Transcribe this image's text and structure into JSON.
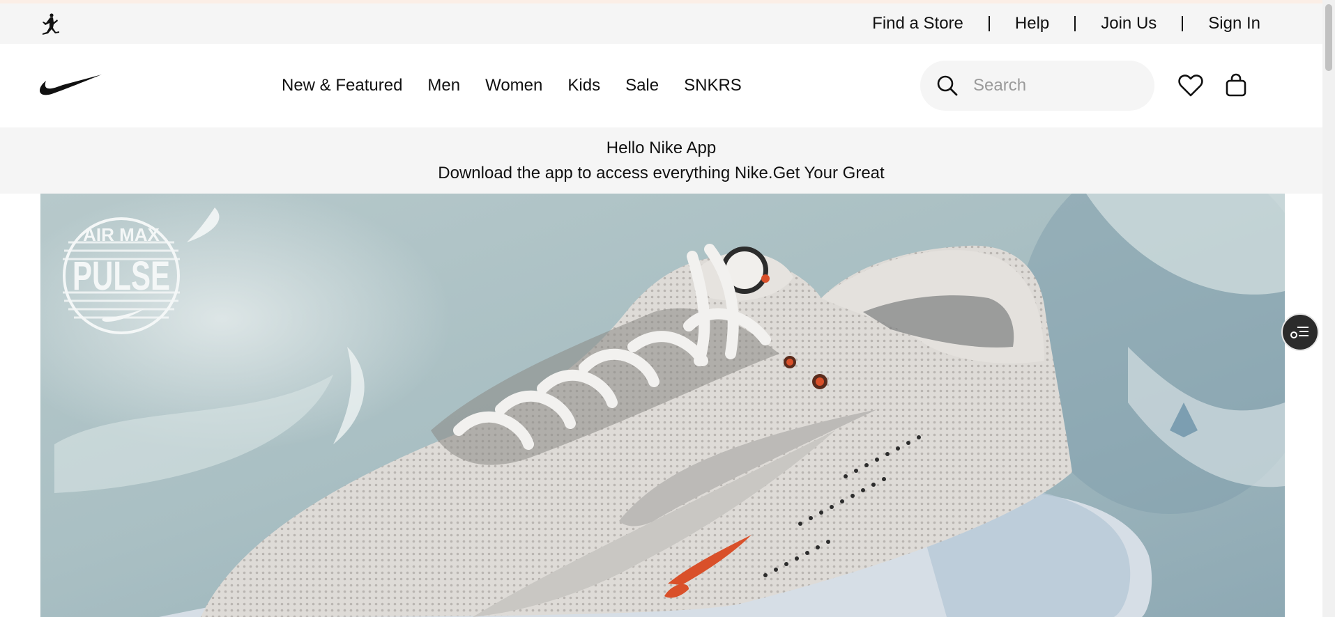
{
  "utility_bar": {
    "links": [
      "Find a Store",
      "Help",
      "Join Us",
      "Sign In"
    ]
  },
  "nav": {
    "items": [
      "New & Featured",
      "Men",
      "Women",
      "Kids",
      "Sale",
      "SNKRS"
    ]
  },
  "search": {
    "placeholder": "Search"
  },
  "promo": {
    "title": "Hello Nike App",
    "subtitle": "Download the app to access everything Nike.",
    "cta": "Get Your Great"
  },
  "hero": {
    "logo_text_top": "AIR MAX",
    "logo_text_main": "PULSE"
  },
  "icons": {
    "brand_logo": "jordan-jumpman-icon",
    "main_logo": "nike-swoosh-icon",
    "search": "search-icon",
    "favorites": "heart-icon",
    "bag": "bag-icon",
    "floating": "checklist-icon"
  },
  "colors": {
    "accent_orange": "#d9502a",
    "utility_bg": "#f5f5f5",
    "text": "#111111"
  }
}
